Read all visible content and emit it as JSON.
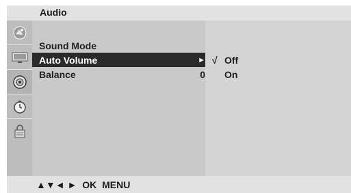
{
  "header": {
    "title": "Audio"
  },
  "sidebar": {
    "icons": [
      "picture-icon",
      "screen-icon",
      "audio-icon",
      "clock-icon",
      "lock-icon"
    ]
  },
  "menu": {
    "items": [
      {
        "label": "Sound Mode",
        "value": ""
      },
      {
        "label": "Auto Volume",
        "value": "►",
        "selected": true
      },
      {
        "label": "Balance",
        "value": "0"
      }
    ]
  },
  "submenu": {
    "check_mark": "√",
    "options": [
      {
        "label": "Off",
        "checked": true
      },
      {
        "label": "On",
        "checked": false
      }
    ]
  },
  "footer": {
    "arrows": "▲▼◄ ►",
    "ok_label": "OK",
    "menu_label": "MENU"
  }
}
